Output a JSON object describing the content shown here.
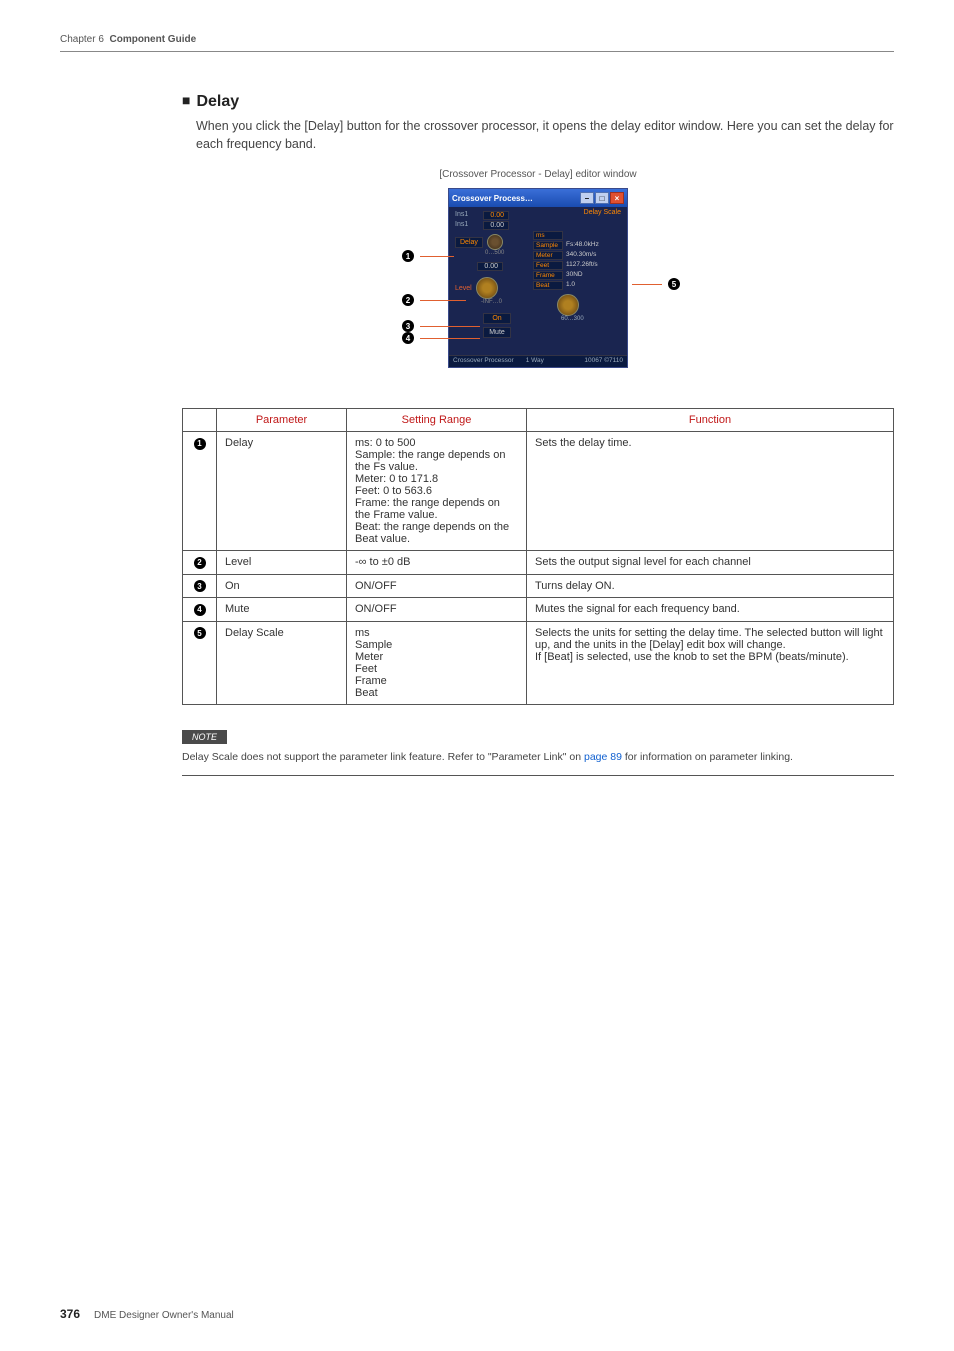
{
  "header": {
    "chapter": "Chapter 6",
    "title": "Component Guide"
  },
  "section": {
    "bullet": "■",
    "title": "Delay",
    "desc": "When you click the [Delay] button for the crossover processor, it opens the delay editor window. Here you can set the delay for each frequency band."
  },
  "figure": {
    "caption": "[Crossover Processor - Delay] editor window",
    "window": {
      "title": "Crossover Process…",
      "ins1_label": "Ins1",
      "ins1_val": "0.00",
      "ins1b_label": "Ins1",
      "ins1b_val": "0.00",
      "delay_label": "Delay",
      "delay_range": "0…500",
      "level_val": "0.00",
      "level_label": "Level",
      "level_range": "-INF…0",
      "on_label": "On",
      "mute_label": "Mute",
      "dscale_title": "Delay Scale",
      "ds_ms_btn": "ms",
      "ds_sample_btn": "Sample",
      "ds_sample_val": "Fs:48.0kHz",
      "ds_meter_btn": "Meter",
      "ds_meter_val": "340.30m/s",
      "ds_feet_btn": "Feet",
      "ds_feet_val": "1127.26ft/s",
      "ds_frame_btn": "Frame",
      "ds_frame_val": "30ND",
      "ds_beat_btn": "Beat",
      "ds_beat_val": "1.0",
      "bpm_range": "60…300",
      "status_left": "Crossover Processor",
      "status_mid": "1 Way",
      "status_right": "10067 ©7110"
    },
    "callouts": {
      "c1": "1",
      "c2": "2",
      "c3": "3",
      "c4": "4",
      "c5": "5"
    }
  },
  "table": {
    "headers": {
      "num": "",
      "param": "Parameter",
      "range": "Setting Range",
      "func": "Function"
    },
    "rows": [
      {
        "num": "1",
        "param": "Delay",
        "range": "ms: 0 to 500\nSample: the range depends on the Fs value.\nMeter: 0 to 171.8\nFeet: 0 to 563.6\nFrame: the range depends on the Frame value.\nBeat: the range depends on the Beat value.",
        "func": "Sets the delay time."
      },
      {
        "num": "2",
        "param": "Level",
        "range": "-∞ to ±0 dB",
        "func": "Sets the output signal level for each channel"
      },
      {
        "num": "3",
        "param": "On",
        "range": "ON/OFF",
        "func": "Turns delay ON."
      },
      {
        "num": "4",
        "param": "Mute",
        "range": "ON/OFF",
        "func": "Mutes the signal for each frequency band."
      },
      {
        "num": "5",
        "param": "Delay Scale",
        "range": "ms\nSample\nMeter\nFeet\nFrame\nBeat",
        "func": "Selects the units for setting the delay time. The selected button will light up, and the units in the [Delay] edit box will change.\nIf [Beat] is selected, use the knob to set the BPM (beats/minute)."
      }
    ]
  },
  "note": {
    "badge": "NOTE",
    "text_before": "Delay Scale does not support the parameter link feature. Refer to \"Parameter Link\" on ",
    "link": "page 89",
    "text_after": " for information on parameter linking."
  },
  "footer": {
    "page": "376",
    "doc": "DME Designer Owner's Manual"
  }
}
